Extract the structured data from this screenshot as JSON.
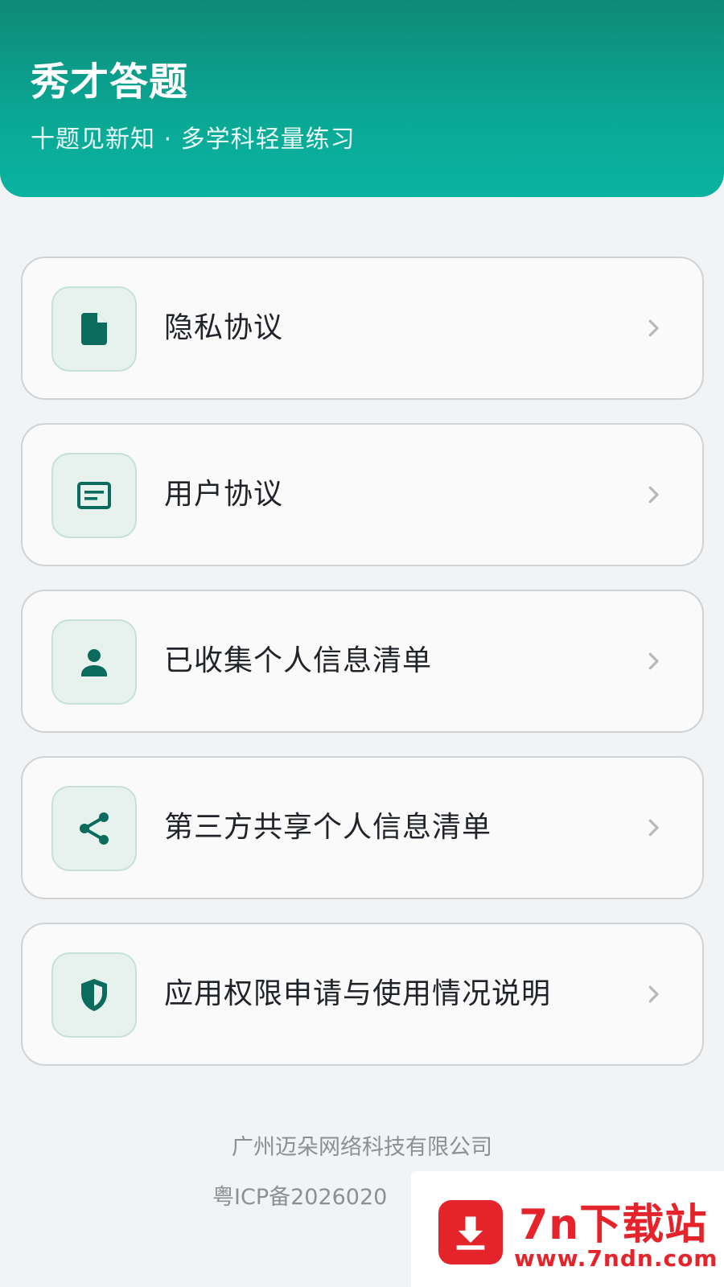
{
  "header": {
    "title": "秀才答题",
    "subtitle": "十题见新知 · 多学科轻量练习"
  },
  "menu": {
    "items": [
      {
        "label": "隐私协议",
        "icon": "document-icon"
      },
      {
        "label": "用户协议",
        "icon": "card-icon"
      },
      {
        "label": "已收集个人信息清单",
        "icon": "person-icon"
      },
      {
        "label": "第三方共享个人信息清单",
        "icon": "share-icon"
      },
      {
        "label": "应用权限申请与使用情况说明",
        "icon": "shield-icon"
      }
    ]
  },
  "footer": {
    "company": "广州迈朵网络科技有限公司",
    "icp": "粤ICP备2026020"
  },
  "watermark": {
    "title": "7n下载站",
    "url": "www.7ndn.com"
  },
  "colors": {
    "accent": "#0b6b5c",
    "header_gradient_top": "#0f8a78",
    "header_gradient_bottom": "#09b3a1",
    "watermark_red": "#e4232b"
  }
}
